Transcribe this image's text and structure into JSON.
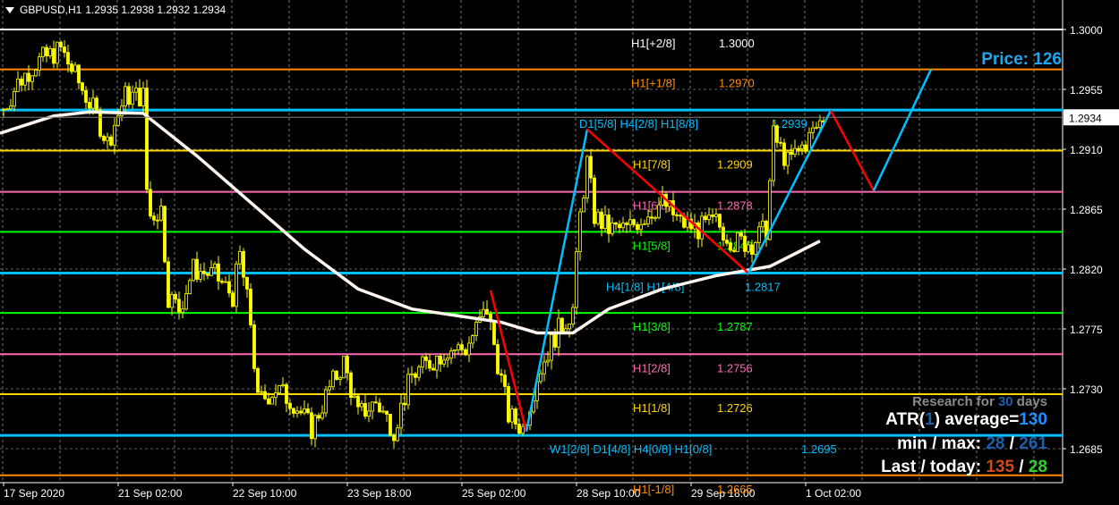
{
  "header": {
    "symbol": "GBPUSD,H1",
    "ohlc": "1.2935 1.2938 1.2932 1.2934"
  },
  "price_label": {
    "prefix": "Price: ",
    "value": "126"
  },
  "info": {
    "research_pre": "Research for ",
    "research_days": "30",
    "research_post": " days",
    "atr_pre": "ATR(",
    "atr_period": "1",
    "atr_mid": ") average=",
    "atr_avg": "130",
    "minmax_pre": "min / max: ",
    "min": "28",
    "sep": " / ",
    "max": "261",
    "last_pre": "Last / today: ",
    "last": "135",
    "today": "28"
  },
  "colors": {
    "bg": "#000000",
    "candle": "#ffff00",
    "ma": "#fff5ee",
    "zig_down": "#ff0000",
    "zig_up": "#00bfff",
    "grid": "#c0c0c0"
  },
  "chart_data": {
    "type": "candlestick",
    "title": "GBPUSD,H1",
    "ylim": [
      1.265,
      1.3022
    ],
    "y_ticks": [
      "1.3000",
      "1.2955",
      "1.2910",
      "1.2865",
      "1.2820",
      "1.2775",
      "1.2730",
      "1.2685"
    ],
    "current_price": "1.2934",
    "x_ticks": [
      {
        "bar": 1,
        "label": "17 Sep 2020"
      },
      {
        "bar": 33,
        "label": "21 Sep 02:00"
      },
      {
        "bar": 65,
        "label": "22 Sep 10:00"
      },
      {
        "bar": 97,
        "label": "23 Sep 18:00"
      },
      {
        "bar": 129,
        "label": "25 Sep 02:00"
      },
      {
        "bar": 161,
        "label": "28 Sep 10:00"
      },
      {
        "bar": 193,
        "label": "29 Sep 18:00"
      },
      {
        "bar": 225,
        "label": "1 Oct 02:00"
      }
    ],
    "close_keypoints": [
      [
        1,
        1.294
      ],
      [
        5,
        1.296
      ],
      [
        10,
        1.2975
      ],
      [
        17,
        1.2985
      ],
      [
        22,
        1.296
      ],
      [
        27,
        1.2935
      ],
      [
        30,
        1.2915
      ],
      [
        35,
        1.295
      ],
      [
        40,
        1.295
      ],
      [
        41,
        1.288
      ],
      [
        42,
        1.286
      ],
      [
        45,
        1.2865
      ],
      [
        47,
        1.28
      ],
      [
        50,
        1.279
      ],
      [
        54,
        1.282
      ],
      [
        60,
        1.2815
      ],
      [
        65,
        1.28
      ],
      [
        67,
        1.283
      ],
      [
        70,
        1.278
      ],
      [
        72,
        1.272
      ],
      [
        77,
        1.273
      ],
      [
        82,
        1.272
      ],
      [
        87,
        1.27
      ],
      [
        92,
        1.273
      ],
      [
        96,
        1.275
      ],
      [
        100,
        1.271
      ],
      [
        105,
        1.272
      ],
      [
        110,
        1.27
      ],
      [
        115,
        1.274
      ],
      [
        120,
        1.275
      ],
      [
        125,
        1.276
      ],
      [
        130,
        1.276
      ],
      [
        136,
        1.279
      ],
      [
        139,
        1.275
      ],
      [
        142,
        1.271
      ],
      [
        146,
        1.27
      ],
      [
        150,
        1.274
      ],
      [
        155,
        1.277
      ],
      [
        160,
        1.279
      ],
      [
        162,
        1.286
      ],
      [
        164,
        1.29
      ],
      [
        166,
        1.286
      ],
      [
        170,
        1.285
      ],
      [
        175,
        1.285
      ],
      [
        180,
        1.286
      ],
      [
        185,
        1.287
      ],
      [
        190,
        1.2855
      ],
      [
        195,
        1.285
      ],
      [
        200,
        1.2855
      ],
      [
        205,
        1.284
      ],
      [
        210,
        1.284
      ],
      [
        214,
        1.285
      ],
      [
        216,
        1.292
      ],
      [
        220,
        1.29
      ],
      [
        225,
        1.2915
      ],
      [
        230,
        1.2934
      ]
    ],
    "ma_keypoints": [
      [
        0,
        1.2922
      ],
      [
        15,
        1.2935
      ],
      [
        25,
        1.2938
      ],
      [
        40,
        1.2937
      ],
      [
        55,
        1.2905
      ],
      [
        70,
        1.287
      ],
      [
        85,
        1.2835
      ],
      [
        100,
        1.2805
      ],
      [
        115,
        1.279
      ],
      [
        130,
        1.2784
      ],
      [
        140,
        1.278
      ],
      [
        150,
        1.2772
      ],
      [
        160,
        1.2772
      ],
      [
        170,
        1.279
      ],
      [
        185,
        1.2805
      ],
      [
        200,
        1.2815
      ],
      [
        215,
        1.2822
      ],
      [
        229,
        1.2841
      ]
    ],
    "zigzag": [
      [
        137,
        1.2804
      ],
      [
        147,
        1.2698
      ],
      [
        164,
        1.2925
      ],
      [
        209,
        1.2817
      ],
      [
        232,
        1.2939
      ],
      [
        244,
        1.2879
      ],
      [
        260,
        1.297
      ]
    ],
    "levels": [
      {
        "price": 1.3,
        "color": "#ffffff",
        "label": "H1[+2/8]",
        "value": "1.3000",
        "lx": 705,
        "vx": 803
      },
      {
        "price": 1.297,
        "color": "#ff8c00",
        "label": "H1[+1/8]",
        "value": "1.2970",
        "lx": 705,
        "vx": 803
      },
      {
        "price": 1.29395,
        "color": "#00bfff",
        "label": "D1[5/8] H4[2/8] H1[8/8]",
        "value": "1.2939",
        "lx": 647,
        "vx": 862
      },
      {
        "price": 1.2909,
        "color": "#ffd700",
        "label": "H1[7/8]",
        "value": "1.2909",
        "lx": 707,
        "vx": 801
      },
      {
        "price": 1.2878,
        "color": "#ff69b4",
        "label": "H1[6/8]",
        "value": "1.2878",
        "lx": 707,
        "vx": 801
      },
      {
        "price": 1.2848,
        "color": "#00ff00",
        "label": "H1[5/8]",
        "value": "1.2848",
        "lx": 707,
        "vx": 801
      },
      {
        "price": 1.2817,
        "color": "#00bfff",
        "label": "H4[1/8] H1[4/8]",
        "value": "1.2817",
        "lx": 677,
        "vx": 832
      },
      {
        "price": 1.2787,
        "color": "#00ff00",
        "label": "H1[3/8]",
        "value": "1.2787",
        "lx": 707,
        "vx": 801
      },
      {
        "price": 1.2756,
        "color": "#ff69b4",
        "label": "H1[2/8]",
        "value": "1.2756",
        "lx": 707,
        "vx": 801
      },
      {
        "price": 1.2726,
        "color": "#ffd700",
        "label": "H1[1/8]",
        "value": "1.2726",
        "lx": 707,
        "vx": 801
      },
      {
        "price": 1.2695,
        "color": "#00bfff",
        "label": "W1[2/8] D1[4/8] H4[0/8] H1[0/8]",
        "value": "1.2695",
        "lx": 614,
        "vx": 895
      },
      {
        "price": 1.2665,
        "color": "#ff8c00",
        "label": "H1[-1/8]",
        "value": "1.2665",
        "lx": 707,
        "vx": 801
      }
    ]
  }
}
